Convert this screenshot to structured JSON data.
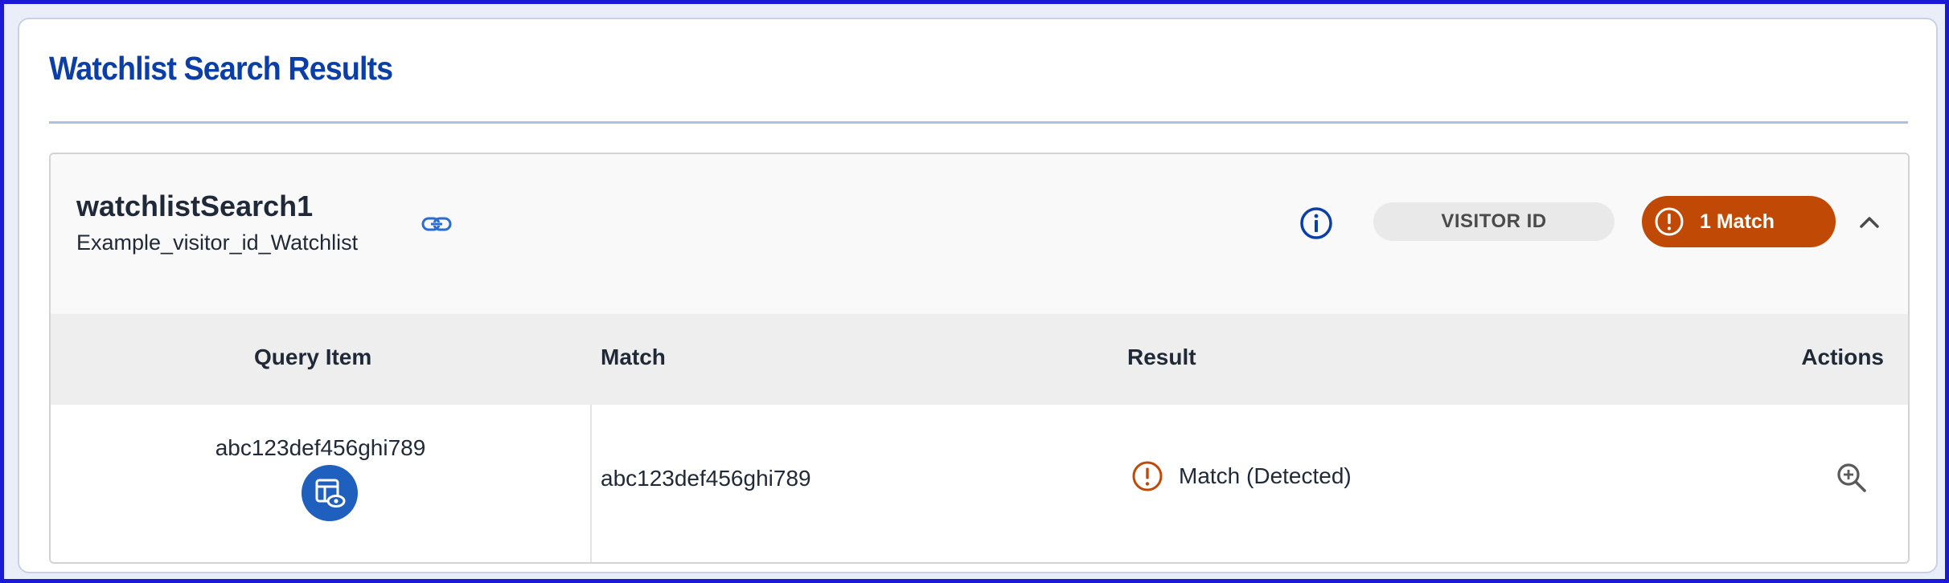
{
  "page": {
    "title": "Watchlist Search Results"
  },
  "search": {
    "name": "watchlistSearch1",
    "subtitle": "Example_visitor_id_Watchlist",
    "type_label": "VISITOR ID",
    "match_label": "1 Match"
  },
  "table": {
    "headers": {
      "query_item": "Query Item",
      "match": "Match",
      "result": "Result",
      "actions": "Actions"
    },
    "rows": [
      {
        "query_item": "abc123def456ghi789",
        "match": "abc123def456ghi789",
        "result": "Match (Detected)"
      }
    ]
  },
  "icons": {
    "link": "link-icon",
    "info": "info-icon",
    "alert": "alert-circle-icon",
    "collapse": "chevron-up-icon",
    "view_details": "view-record-icon",
    "zoom": "zoom-in-icon"
  },
  "colors": {
    "title_blue": "#0b3fa7",
    "match_orange": "#c04a05",
    "query_icon_blue": "#1f5fbe",
    "outer_border": "#1a1ad6"
  }
}
